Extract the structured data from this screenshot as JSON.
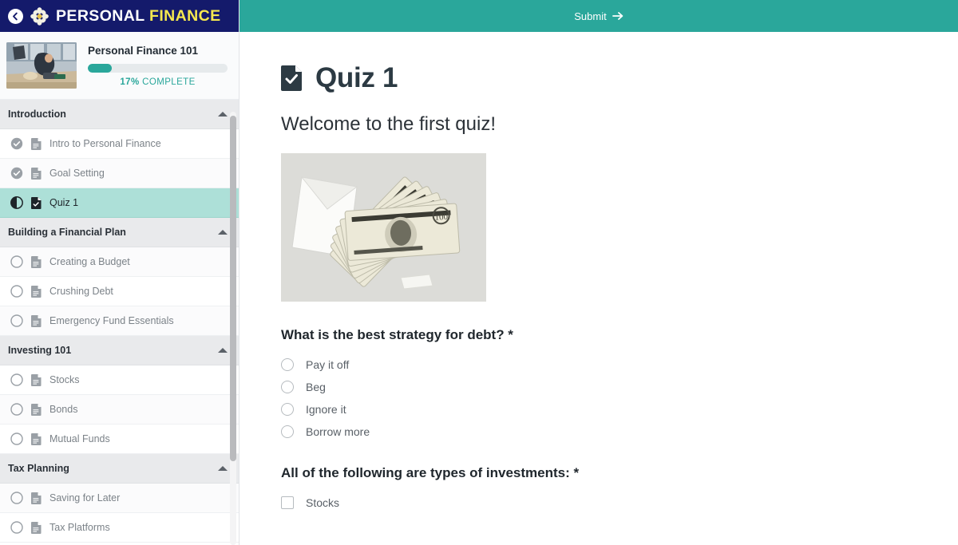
{
  "brand": {
    "name_part1": "PERSONAL",
    "name_part2": "FINANCE",
    "back_icon": "back-arrow-icon",
    "logo_icon": "flower-logo-icon",
    "navy": "#141a6b",
    "accent_yellow": "#f5e84f"
  },
  "topbar": {
    "submit_label": "Submit",
    "submit_arrow": "→",
    "teal": "#2aa79b"
  },
  "course": {
    "title": "Personal Finance 101",
    "progress_percent": 17,
    "progress_label_number": "17%",
    "progress_label_text": " COMPLETE",
    "thumbnail_alt": "workshop-photo"
  },
  "sidebar": {
    "sections": [
      {
        "title": "Introduction",
        "collapse_icon": "caret-up-icon",
        "items": [
          {
            "label": "Intro to Personal Finance",
            "status": "complete",
            "doc_icon": "document-icon",
            "active": false
          },
          {
            "label": "Goal Setting",
            "status": "complete",
            "doc_icon": "document-icon",
            "active": false
          },
          {
            "label": "Quiz 1",
            "status": "in-progress",
            "doc_icon": "quiz-document-icon",
            "active": true
          }
        ]
      },
      {
        "title": "Building a Financial Plan",
        "collapse_icon": "caret-up-icon",
        "items": [
          {
            "label": "Creating a Budget",
            "status": "incomplete",
            "doc_icon": "document-icon",
            "active": false
          },
          {
            "label": "Crushing Debt",
            "status": "incomplete",
            "doc_icon": "document-icon",
            "active": false
          },
          {
            "label": "Emergency Fund Essentials",
            "status": "incomplete",
            "doc_icon": "document-icon",
            "active": false
          }
        ]
      },
      {
        "title": "Investing 101",
        "collapse_icon": "caret-up-icon",
        "items": [
          {
            "label": "Stocks",
            "status": "incomplete",
            "doc_icon": "document-icon",
            "active": false
          },
          {
            "label": "Bonds",
            "status": "incomplete",
            "doc_icon": "document-icon",
            "active": false
          },
          {
            "label": "Mutual Funds",
            "status": "incomplete",
            "doc_icon": "document-icon",
            "active": false
          }
        ]
      },
      {
        "title": "Tax Planning",
        "collapse_icon": "caret-up-icon",
        "items": [
          {
            "label": "Saving for Later",
            "status": "incomplete",
            "doc_icon": "document-icon",
            "active": false
          },
          {
            "label": "Tax Platforms",
            "status": "incomplete",
            "doc_icon": "document-icon",
            "active": false
          }
        ]
      }
    ]
  },
  "main": {
    "quiz_icon": "quiz-document-icon",
    "quiz_title": "Quiz 1",
    "welcome_text": "Welcome to the first quiz!",
    "image_alt": "money-envelope-photo",
    "questions": [
      {
        "text": "What is the best strategy for debt? *",
        "input_type": "radio",
        "options": [
          "Pay it off",
          "Beg",
          "Ignore it",
          "Borrow more"
        ]
      },
      {
        "text": "All of the following are types of investments: *",
        "input_type": "checkbox",
        "options": [
          "Stocks"
        ]
      }
    ]
  }
}
